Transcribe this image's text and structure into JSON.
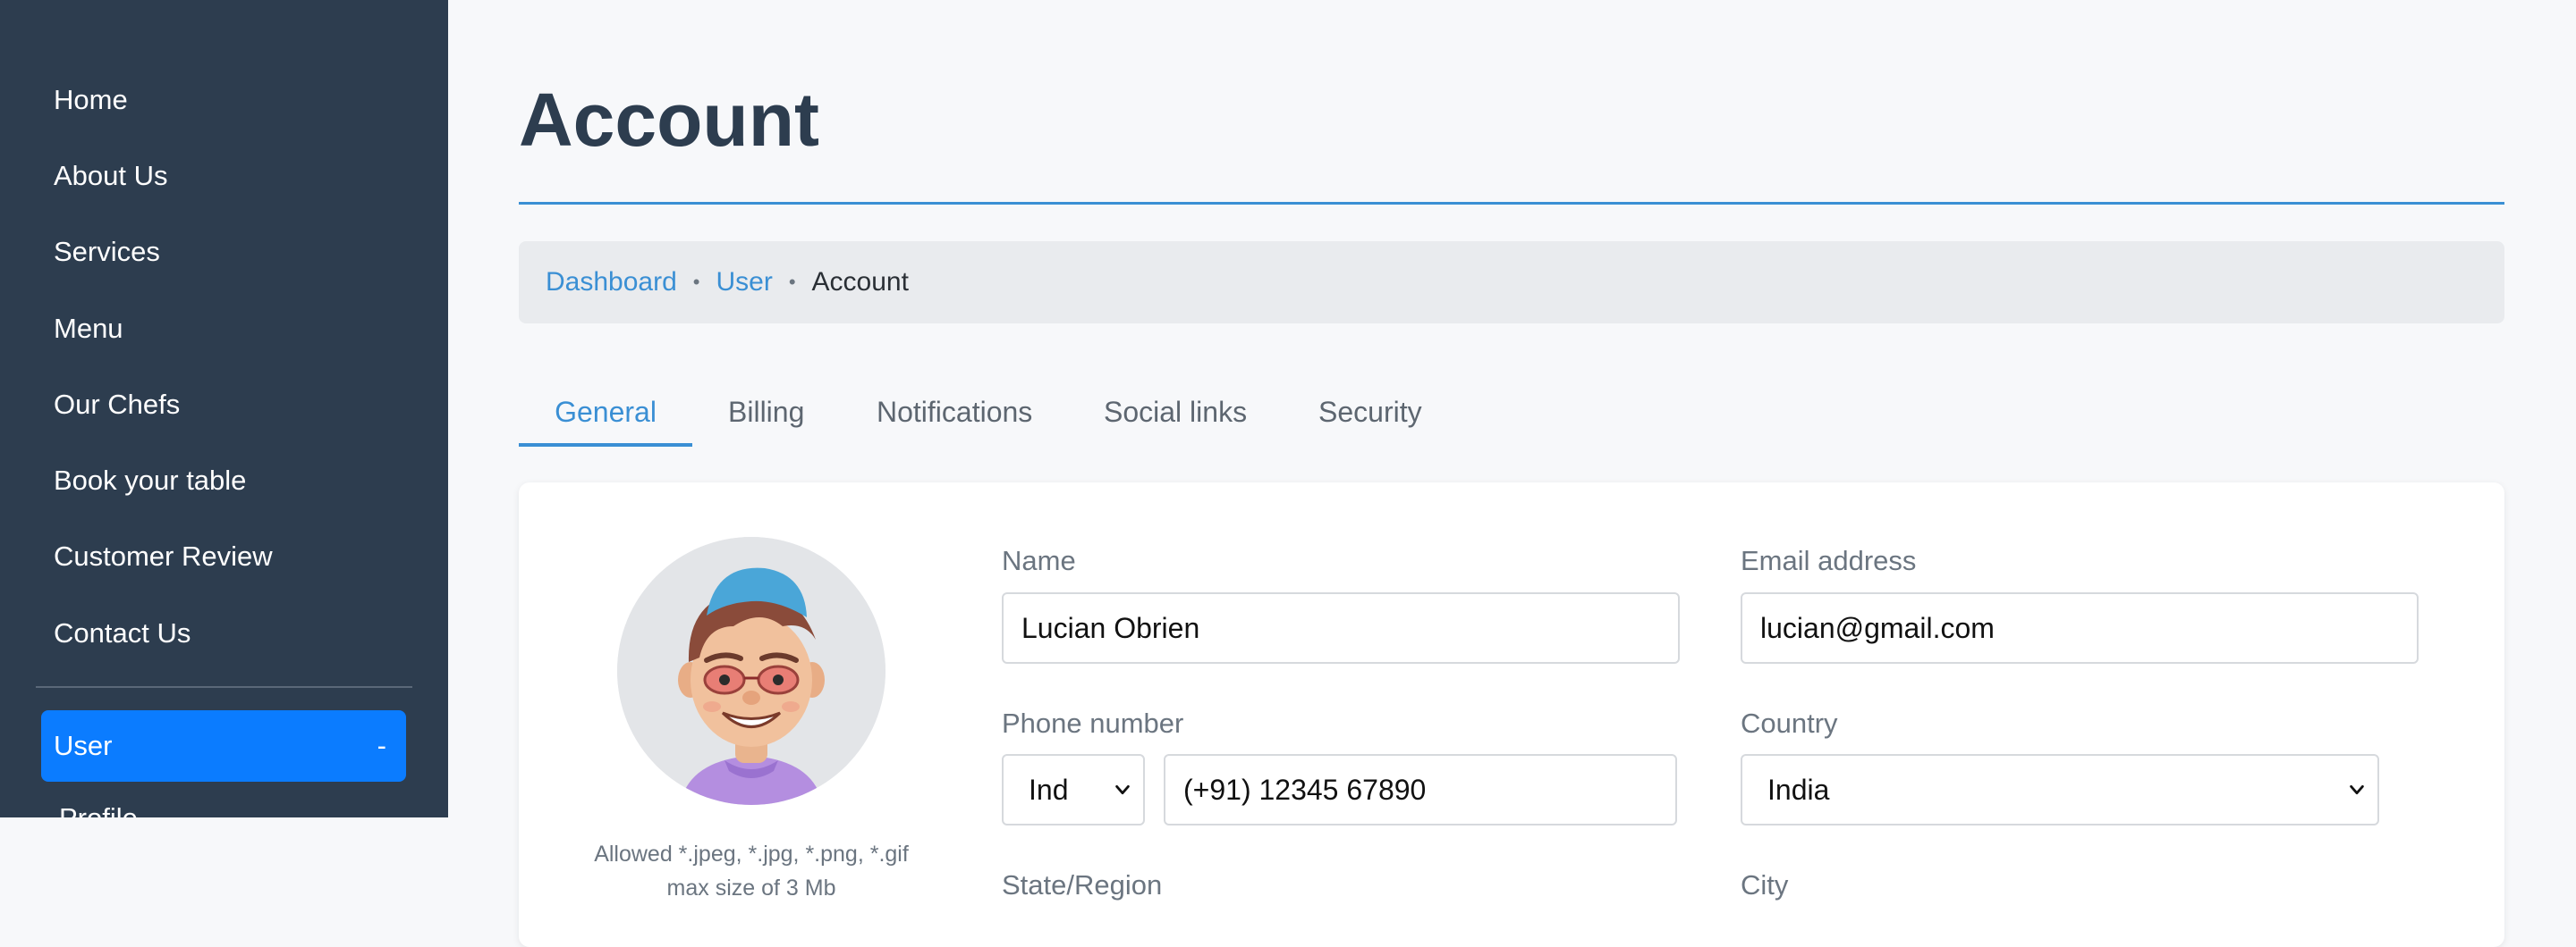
{
  "sidebar": {
    "items": [
      {
        "label": "Home"
      },
      {
        "label": "About Us"
      },
      {
        "label": "Services"
      },
      {
        "label": "Menu"
      },
      {
        "label": "Our Chefs"
      },
      {
        "label": "Book your table"
      },
      {
        "label": "Customer Review"
      },
      {
        "label": "Contact Us"
      }
    ],
    "user_label": "User",
    "user_toggle": "-",
    "sub_item_partial": "Profile"
  },
  "page": {
    "title": "Account"
  },
  "breadcrumb": {
    "items": [
      "Dashboard",
      "User",
      "Account"
    ],
    "separator": "•"
  },
  "tabs": [
    {
      "label": "General",
      "active": true
    },
    {
      "label": "Billing",
      "active": false
    },
    {
      "label": "Notifications",
      "active": false
    },
    {
      "label": "Social links",
      "active": false
    },
    {
      "label": "Security",
      "active": false
    }
  ],
  "profile": {
    "avatar_note_line1": "Allowed *.jpeg, *.jpg, *.png, *.gif",
    "avatar_note_line2": "max size of 3 Mb"
  },
  "form": {
    "name_label": "Name",
    "name_value": "Lucian Obrien",
    "email_label": "Email address",
    "email_value": "lucian@gmail.com",
    "phone_label": "Phone number",
    "phone_code": "Ind",
    "phone_value": "(+91) 12345 67890",
    "country_label": "Country",
    "country_value": "India",
    "state_label": "State/Region",
    "city_label": "City"
  },
  "colors": {
    "sidebar_bg": "#2d3d4f",
    "accent": "#3a8fd4",
    "user_button": "#0b7cff"
  }
}
